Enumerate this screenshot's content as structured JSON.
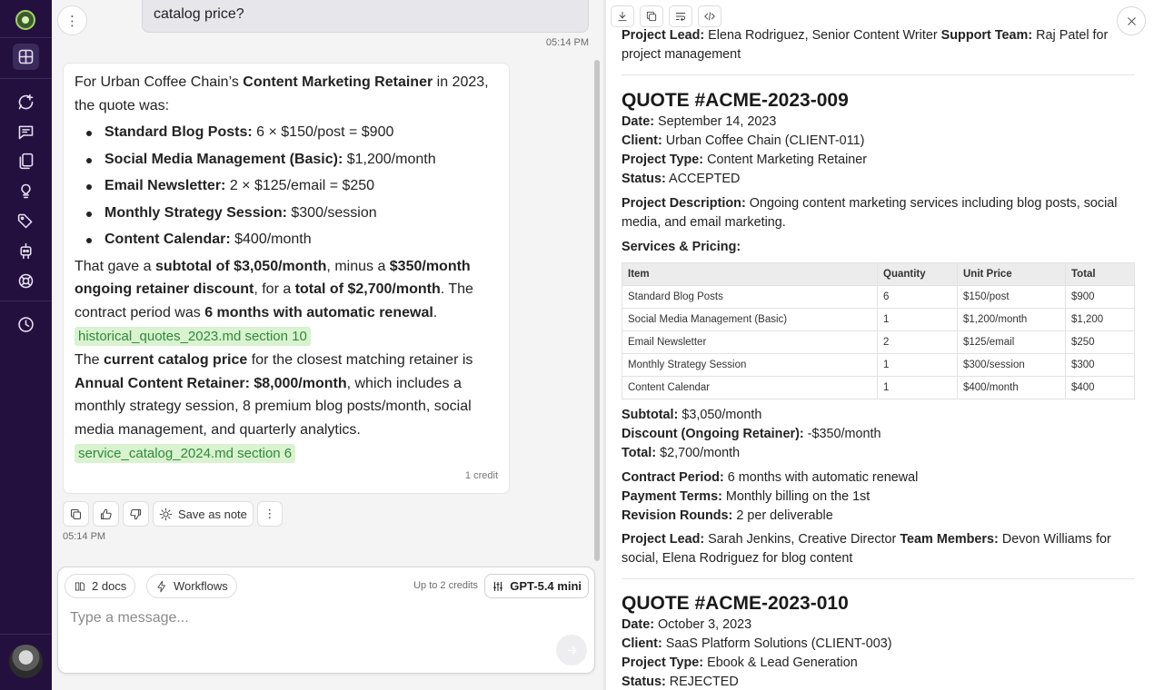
{
  "chat": {
    "user_message": "catalog price?",
    "user_time": "05:14 PM",
    "assistant": {
      "intro_a": "For Urban Coffee Chain’s ",
      "intro_b": "Content Marketing Retainer",
      "intro_c": " in 2023, the quote was:",
      "bullets": [
        {
          "label": "Standard Blog Posts:",
          "value": " 6 × $150/post = $900"
        },
        {
          "label": "Social Media Management (Basic):",
          "value": " $1,200/month"
        },
        {
          "label": "Email Newsletter:",
          "value": " 2 × $125/email = $250"
        },
        {
          "label": "Monthly Strategy Session:",
          "value": " $300/session"
        },
        {
          "label": "Content Calendar:",
          "value": " $400/month"
        }
      ],
      "p2": {
        "t1": "That gave a ",
        "b1": "subtotal of $3,050/month",
        "t2": ", minus a ",
        "b2": "$350/month ongoing retainer discount",
        "t3": ", for a ",
        "b3": "total of $2,700/month",
        "t4": ". The contract period was ",
        "b4": "6 months with automatic renewal",
        "t5": "."
      },
      "cite1": "historical_quotes_2023.md section 10",
      "p3": {
        "t1": "The ",
        "b1": "current catalog price",
        "t2": " for the closest matching retainer is ",
        "b2": "Annual Content Retainer: $8,000/month",
        "t3": ", which includes a monthly strategy session, 8 premium blog posts/month, social media management, and quarterly analytics."
      },
      "cite2": "service_catalog_2024.md section 6",
      "credit": "1 credit"
    },
    "actions": {
      "save_note": "Save as note"
    },
    "assistant_time": "05:14 PM",
    "composer": {
      "docs": "2 docs",
      "workflows": "Workflows",
      "credits_hint": "Up to 2 credits",
      "model": "GPT-5.4 mini",
      "placeholder": "Type a message..."
    }
  },
  "doc": {
    "prev_lead": {
      "l1": "Project Lead:",
      "v1": " Elena Rodriguez, Senior Content Writer ",
      "l2": "Support Team:",
      "v2": " Raj Patel for project management"
    },
    "quote1": {
      "title": "QUOTE #ACME-2023-009",
      "fields": [
        {
          "label": "Date:",
          "value": " September 14, 2023"
        },
        {
          "label": "Client:",
          "value": " Urban Coffee Chain (CLIENT-011)"
        },
        {
          "label": "Project Type:",
          "value": " Content Marketing Retainer"
        },
        {
          "label": "Status:",
          "value": " ACCEPTED"
        }
      ],
      "desc_label": "Project Description:",
      "desc_value": " Ongoing content marketing services including blog posts, social media, and email marketing.",
      "services_heading": "Services & Pricing:",
      "table": {
        "headers": [
          "Item",
          "Quantity",
          "Unit Price",
          "Total"
        ],
        "rows": [
          [
            "Standard Blog Posts",
            "6",
            "$150/post",
            "$900"
          ],
          [
            "Social Media Management (Basic)",
            "1",
            "$1,200/month",
            "$1,200"
          ],
          [
            "Email Newsletter",
            "2",
            "$125/email",
            "$250"
          ],
          [
            "Monthly Strategy Session",
            "1",
            "$300/session",
            "$300"
          ],
          [
            "Content Calendar",
            "1",
            "$400/month",
            "$400"
          ]
        ]
      },
      "totals": [
        {
          "label": "Subtotal:",
          "value": " $3,050/month"
        },
        {
          "label": "Discount (Ongoing Retainer):",
          "value": " -$350/month"
        },
        {
          "label": "Total:",
          "value": " $2,700/month"
        }
      ],
      "terms": [
        {
          "label": "Contract Period:",
          "value": " 6 months with automatic renewal"
        },
        {
          "label": "Payment Terms:",
          "value": " Monthly billing on the 1st"
        },
        {
          "label": "Revision Rounds:",
          "value": " 2 per deliverable"
        }
      ],
      "lead": {
        "l1": "Project Lead:",
        "v1": " Sarah Jenkins, Creative Director ",
        "l2": "Team Members:",
        "v2": " Devon Williams for social, Elena Rodriguez for blog content"
      }
    },
    "quote2": {
      "title": "QUOTE #ACME-2023-010",
      "fields": [
        {
          "label": "Date:",
          "value": " October 3, 2023"
        },
        {
          "label": "Client:",
          "value": " SaaS Platform Solutions (CLIENT-003)"
        },
        {
          "label": "Project Type:",
          "value": " Ebook & Lead Generation"
        },
        {
          "label": "Status:",
          "value": " REJECTED"
        }
      ]
    }
  }
}
